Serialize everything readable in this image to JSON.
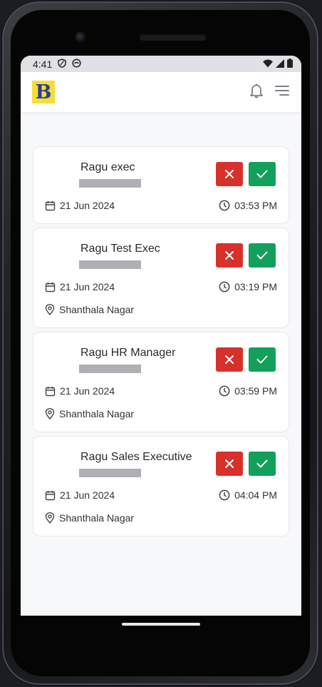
{
  "status_bar": {
    "time": "4:41"
  },
  "app": {
    "logo_letter": "B"
  },
  "cards": [
    {
      "name": "Ragu exec",
      "date": "21 Jun 2024",
      "time": "03:53 PM",
      "location": ""
    },
    {
      "name": "Ragu Test Exec",
      "date": "21 Jun 2024",
      "time": "03:19 PM",
      "location": "Shanthala Nagar"
    },
    {
      "name": "Ragu HR Manager",
      "date": "21 Jun 2024",
      "time": "03:59 PM",
      "location": "Shanthala Nagar"
    },
    {
      "name": "Ragu Sales Executive",
      "date": "21 Jun 2024",
      "time": "04:04 PM",
      "location": "Shanthala Nagar"
    }
  ],
  "colors": {
    "reject": "#d8312b",
    "accept": "#12a05a",
    "logo_bg": "#f5dd3a",
    "logo_fg": "#2b3e9a"
  }
}
